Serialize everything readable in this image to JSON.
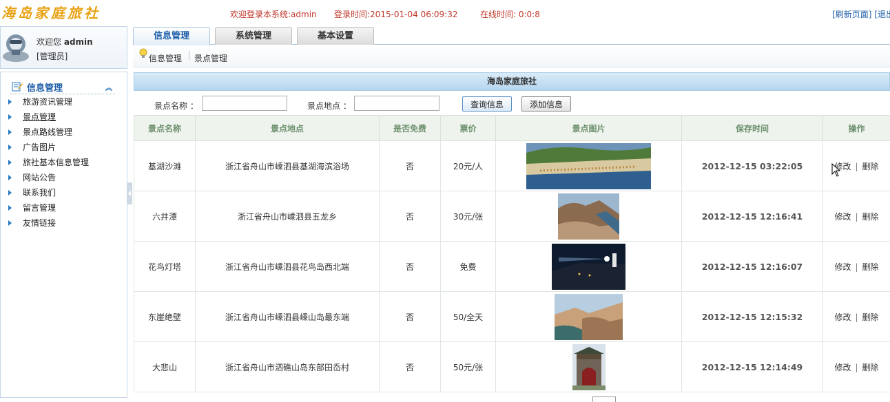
{
  "header": {
    "logo": "海岛家庭旅社",
    "welcome": "欢迎登录本系统:admin",
    "login_time": "登录时间:2015-01-04 06:09:32",
    "online_time": "在线时间: 0:0:8",
    "refresh_link": "[刷新页面]",
    "logout_link": "[退出"
  },
  "user": {
    "greeting": "欢迎您",
    "name": "admin",
    "role": "[管理员]"
  },
  "sidebar": {
    "section_title": "信息管理",
    "items": [
      {
        "label": "旅游资讯管理"
      },
      {
        "label": "景点管理"
      },
      {
        "label": "景点路线管理"
      },
      {
        "label": "广告图片"
      },
      {
        "label": "旅社基本信息管理"
      },
      {
        "label": "网站公告"
      },
      {
        "label": "联系我们"
      },
      {
        "label": "留言管理"
      },
      {
        "label": "友情链接"
      }
    ]
  },
  "tabs": [
    {
      "label": "信息管理"
    },
    {
      "label": "系统管理"
    },
    {
      "label": "基本设置"
    }
  ],
  "breadcrumb": {
    "level1": "信息管理",
    "level2": "景点管理"
  },
  "panel": {
    "title": "海岛家庭旅社"
  },
  "search": {
    "name_label": "景点名称 ：",
    "name_value": "",
    "place_label": "景点地点 ：",
    "place_value": "",
    "query_button": "查询信息",
    "add_button": "添加信息"
  },
  "table": {
    "headers": [
      "景点名称",
      "景点地点",
      "是否免费",
      "票价",
      "景点图片",
      "保存时间",
      "操作"
    ],
    "rows": [
      {
        "name": "基湖沙滩",
        "place": "浙江省舟山市嵊泗县基湖海滨浴场",
        "free": "否",
        "price": "20元/人",
        "time": "2012-12-15 03:22:05",
        "edit": "修改",
        "delete": "删除"
      },
      {
        "name": "六井潭",
        "place": "浙江省舟山市嵊泗县五龙乡",
        "free": "否",
        "price": "30元/张",
        "time": "2012-12-15 12:16:41",
        "edit": "修改",
        "delete": "删除"
      },
      {
        "name": "花鸟灯塔",
        "place": "浙江省舟山市嵊泗县花鸟岛西北端",
        "free": "否",
        "price": "免费",
        "time": "2012-12-15 12:16:07",
        "edit": "修改",
        "delete": "删除"
      },
      {
        "name": "东崖绝壁",
        "place": "浙江省舟山市嵊泗县嵊山岛最东端",
        "free": "否",
        "price": "50/全天",
        "time": "2012-12-15 12:15:32",
        "edit": "修改",
        "delete": "删除"
      },
      {
        "name": "大悲山",
        "place": "浙江省舟山市泗礁山岛东部田岙村",
        "free": "否",
        "price": "50元/张",
        "time": "2012-12-15 12:14:49",
        "edit": "修改",
        "delete": "删除"
      }
    ]
  },
  "icons": {
    "avatar": "user-avatar-icon",
    "section": "edit-note-icon",
    "collapse": "double-chevron-up-icon",
    "breadcrumb": "lightbulb-icon",
    "row_bullet": "triangle-right-icon"
  }
}
